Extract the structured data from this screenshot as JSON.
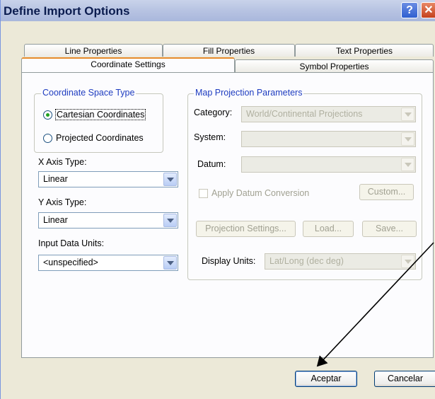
{
  "window": {
    "title": "Define Import Options",
    "help_glyph": "?",
    "close_glyph": "✕"
  },
  "tabs": {
    "row_back": [
      "Line Properties",
      "Fill Properties",
      "Text Properties"
    ],
    "row_front": [
      "Coordinate Settings",
      "Symbol Properties"
    ],
    "active": "Coordinate Settings"
  },
  "coordinate_space": {
    "legend": "Coordinate Space Type",
    "options": [
      "Cartesian Coordinates",
      "Projected Coordinates"
    ],
    "selected": "Cartesian Coordinates"
  },
  "x_axis": {
    "label": "X Axis Type:",
    "value": "Linear"
  },
  "y_axis": {
    "label": "Y Axis Type:",
    "value": "Linear"
  },
  "input_units": {
    "label": "Input Data Units:",
    "value": "<unspecified>"
  },
  "projection": {
    "legend": "Map Projection Parameters",
    "category_label": "Category:",
    "category_value": "World/Continental Projections",
    "system_label": "System:",
    "system_value": "",
    "datum_label": "Datum:",
    "datum_value": "",
    "apply_datum_label": "Apply Datum Conversion",
    "custom_button": "Custom...",
    "projection_settings_button": "Projection Settings...",
    "load_button": "Load...",
    "save_button": "Save...",
    "display_units_label": "Display Units:",
    "display_units_value": "Lat/Long (dec deg)"
  },
  "footer": {
    "ok_button": "Aceptar",
    "cancel_button": "Cancelar"
  },
  "colors": {
    "accent_tab": "#e68b2c",
    "group_legend": "#1e3cc0",
    "dialog_bg": "#ece9d8"
  }
}
